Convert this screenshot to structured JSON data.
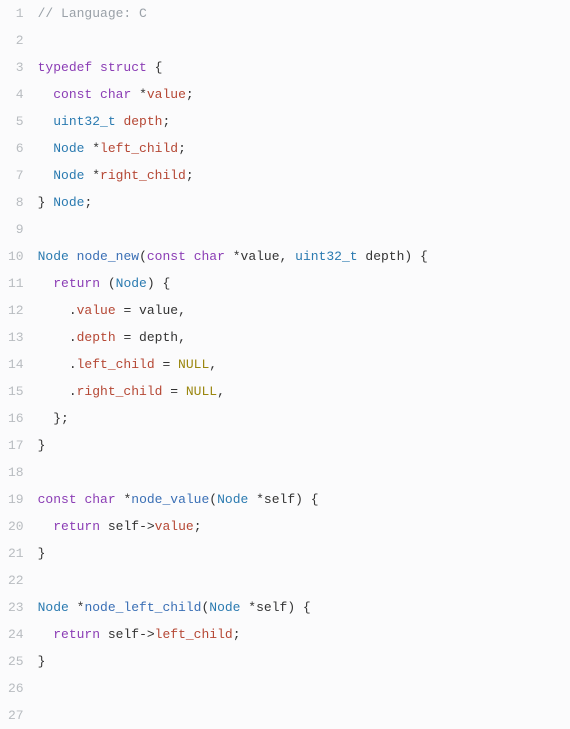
{
  "language_comment": "// Language: C",
  "lines": {
    "count": 27
  },
  "code": {
    "l1": {
      "comment": "// Language: C"
    },
    "l3": {
      "kw_typedef": "typedef",
      "kw_struct": "struct",
      "brace": " {"
    },
    "l4": {
      "indent": "  ",
      "kw_const": "const",
      "sp1": " ",
      "kw_char": "char",
      "sp2": " *",
      "field": "value",
      "semi": ";"
    },
    "l5": {
      "indent": "  ",
      "type": "uint32_t",
      "sp": " ",
      "field": "depth",
      "semi": ";"
    },
    "l6": {
      "indent": "  ",
      "type": "Node",
      "sp": " *",
      "field": "left_child",
      "semi": ";"
    },
    "l7": {
      "indent": "  ",
      "type": "Node",
      "sp": " *",
      "field": "right_child",
      "semi": ";"
    },
    "l8": {
      "close": "} ",
      "type": "Node",
      "semi": ";"
    },
    "l10": {
      "type1": "Node",
      "sp1": " ",
      "func": "node_new",
      "p1": "(",
      "kw_const": "const",
      "sp2": " ",
      "kw_char": "char",
      "sp3": " *",
      "arg1": "value",
      "c1": ", ",
      "type2": "uint32_t",
      "sp4": " ",
      "arg2": "depth",
      "p2": ") {"
    },
    "l11": {
      "indent": "  ",
      "kw_return": "return",
      "sp": " (",
      "type": "Node",
      "p": ") {"
    },
    "l12": {
      "indent": "    .",
      "field": "value",
      "eq": " = ",
      "val": "value",
      "c": ","
    },
    "l13": {
      "indent": "    .",
      "field": "depth",
      "eq": " = ",
      "val": "depth",
      "c": ","
    },
    "l14": {
      "indent": "    .",
      "field": "left_child",
      "eq": " = ",
      "val": "NULL",
      "c": ","
    },
    "l15": {
      "indent": "    .",
      "field": "right_child",
      "eq": " = ",
      "val": "NULL",
      "c": ","
    },
    "l16": {
      "indent": "  };",
      "text": "  };"
    },
    "l17": {
      "close": "}"
    },
    "l19": {
      "kw_const": "const",
      "sp1": " ",
      "kw_char": "char",
      "sp2": " *",
      "func": "node_value",
      "p1": "(",
      "type": "Node",
      "sp3": " *",
      "arg": "self",
      "p2": ") {"
    },
    "l20": {
      "indent": "  ",
      "kw_return": "return",
      "sp": " ",
      "var": "self",
      "arrow": "->",
      "field": "value",
      "semi": ";"
    },
    "l21": {
      "close": "}"
    },
    "l23": {
      "type1": "Node",
      "sp1": " *",
      "func": "node_left_child",
      "p1": "(",
      "type2": "Node",
      "sp2": " *",
      "arg": "self",
      "p2": ") {"
    },
    "l24": {
      "indent": "  ",
      "kw_return": "return",
      "sp": " ",
      "var": "self",
      "arrow": "->",
      "field": "left_child",
      "semi": ";"
    },
    "l25": {
      "close": "}"
    }
  }
}
